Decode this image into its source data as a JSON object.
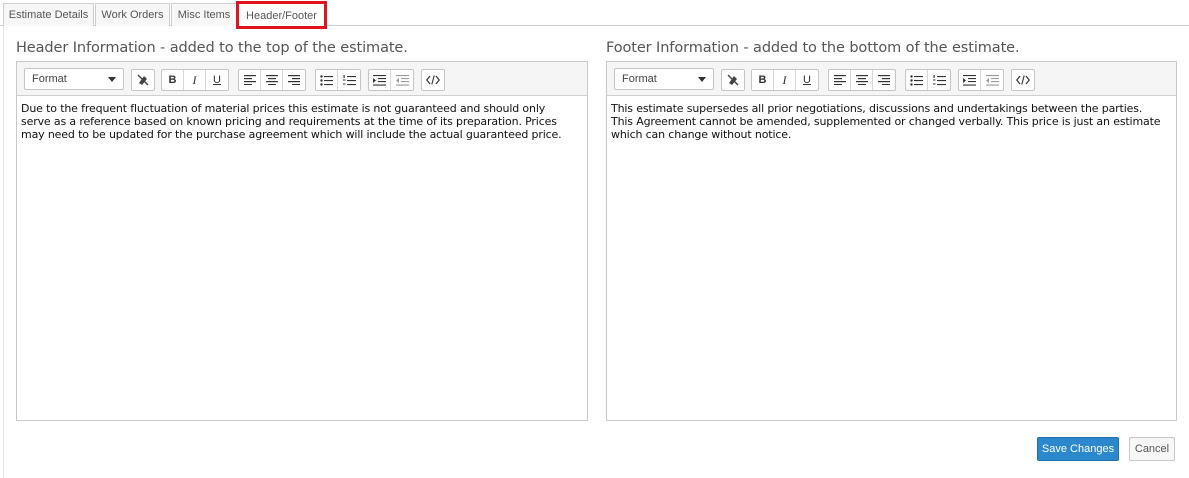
{
  "tabs": [
    {
      "label": "Estimate Details"
    },
    {
      "label": "Work Orders"
    },
    {
      "label": "Misc Items"
    },
    {
      "label": "Header/Footer",
      "active": true
    }
  ],
  "header": {
    "title": "Header Information - added to the top of the estimate.",
    "format_label": "Format",
    "content": "Due to the frequent fluctuation of material prices this estimate is not guaranteed and should only\nserve as a reference based on known pricing and requirements at the time of its preparation. Prices\nmay need to be updated for the purchase agreement which will include the actual guaranteed price."
  },
  "footer": {
    "title": "Footer Information - added to the bottom of the estimate.",
    "format_label": "Format",
    "content": "This estimate supersedes all prior negotiations, discussions and undertakings between the parties.\nThis Agreement cannot be amended, supplemented or changed verbally. This price is just an estimate\nwhich can change without notice."
  },
  "toolbar": {
    "bold": "B",
    "italic": "I",
    "underline": "U",
    "icons": [
      "eraser-icon",
      "bold-icon",
      "italic-icon",
      "underline-icon",
      "align-left-icon",
      "align-center-icon",
      "align-right-icon",
      "bullet-list-icon",
      "numbered-list-icon",
      "indent-icon",
      "outdent-icon",
      "code-view-icon"
    ]
  },
  "actions": {
    "save_label": "Save Changes",
    "cancel_label": "Cancel"
  },
  "colors": {
    "active_tab_outline": "#e0141e",
    "primary_button": "#2b88cc"
  }
}
